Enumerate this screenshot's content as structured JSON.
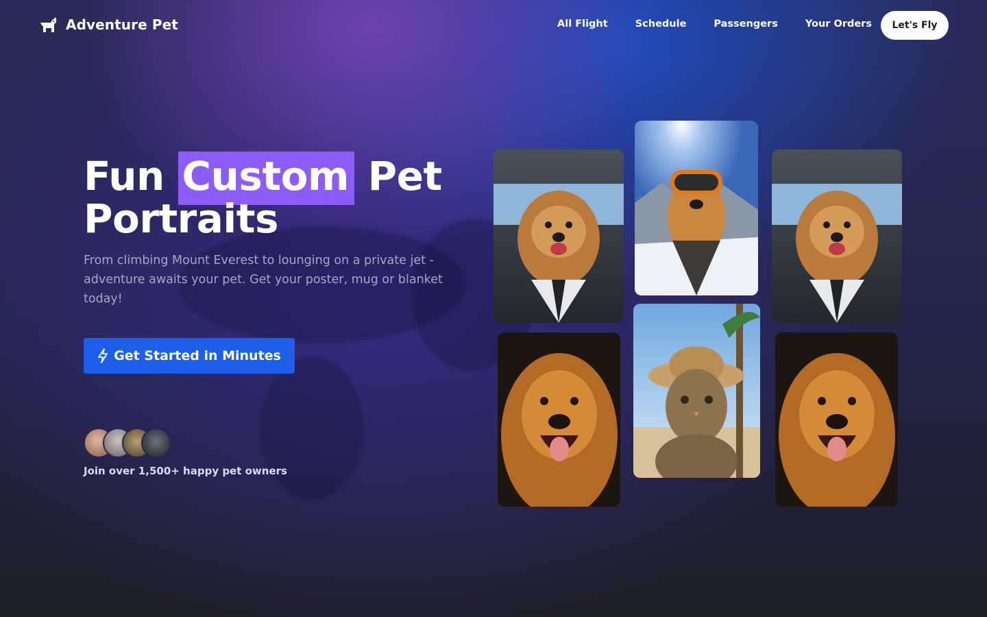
{
  "brand": {
    "name": "Adventure Pet",
    "icon": "dog-logo-icon"
  },
  "nav": {
    "links": [
      "All Flight",
      "Schedule",
      "Passengers",
      "Your Orders"
    ],
    "cta_label": "Let's Fly"
  },
  "hero": {
    "headline_part1": "Fun",
    "headline_highlight": "Custom",
    "headline_part2": "Pet",
    "headline_line2": "Portraits",
    "subtitle": "From climbing Mount Everest to lounging on a private jet - adventure awaits your pet. Get your poster, mug or blanket today!",
    "cta_label": "Get Started in Minutes",
    "cta_icon": "lightning-bolt-icon",
    "social_proof": "Join over 1,500+ happy pet owners",
    "avatar_count": 4
  },
  "gallery": [
    {
      "alt": "dog-pilot-cockpit"
    },
    {
      "alt": "dog-ski-goggles-mountain"
    },
    {
      "alt": "dog-pilot-cockpit"
    },
    {
      "alt": "golden-retriever-smiling"
    },
    {
      "alt": "cat-straw-hat-beach"
    },
    {
      "alt": "golden-retriever-smiling"
    }
  ],
  "colors": {
    "accent_highlight": "#8b5cf6",
    "primary_button": "#1d5fe8",
    "subtitle_text": "#a9a6c4"
  }
}
